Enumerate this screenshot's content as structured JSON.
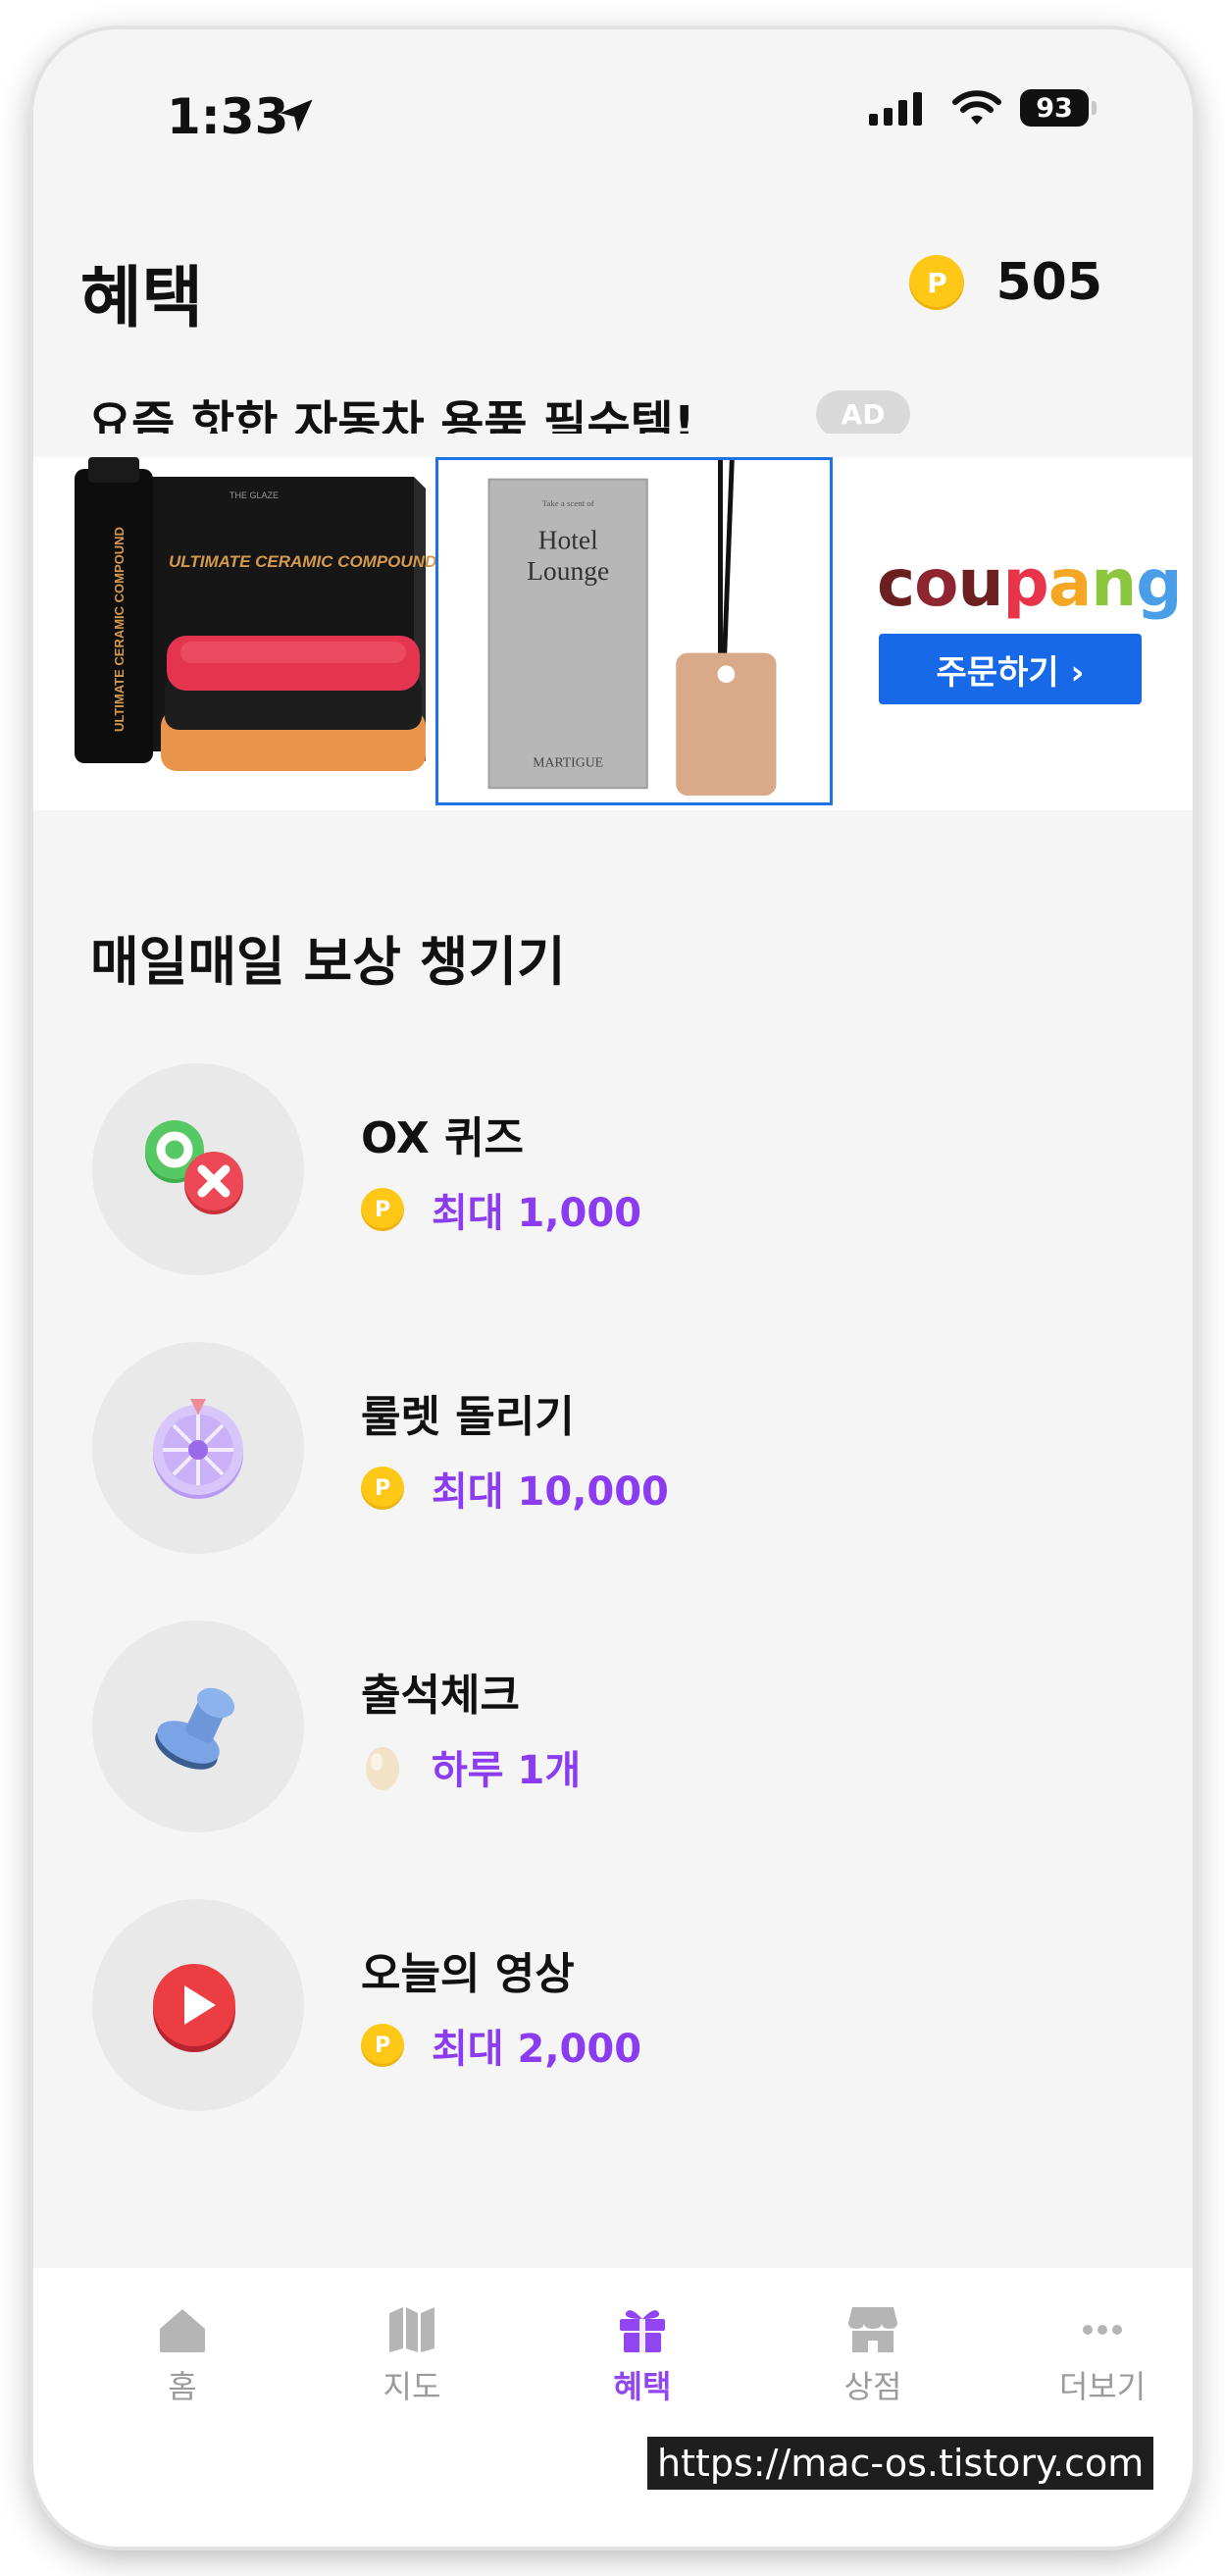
{
  "status_bar": {
    "time": "1:33",
    "battery": "93"
  },
  "header": {
    "title": "혜택",
    "points": "505",
    "coin_symbol": "P"
  },
  "ad": {
    "headline": "요즘 핫한 자동차 용품 필수템!",
    "badge": "AD",
    "product1": {
      "title": "ULTIMATE CERAMIC COMPOUND",
      "side_text": "ULTIMATE CERAMIC COMPOUND",
      "brand": "THE GLAZE"
    },
    "product2": {
      "small_text": "Take a scent of",
      "title_line1": "Hotel",
      "title_line2": "Lounge",
      "brand": "MARTIGUE"
    },
    "brand_logo": "coupang",
    "order_button": "주문하기 ›"
  },
  "rewards": {
    "section_title": "매일매일 보상 챙기기",
    "items": [
      {
        "name": "OX 퀴즈",
        "value": "최대 1,000",
        "icon": "ox-quiz-icon",
        "reward_type": "coin"
      },
      {
        "name": "룰렛 돌리기",
        "value": "최대 10,000",
        "icon": "roulette-icon",
        "reward_type": "coin"
      },
      {
        "name": "출석체크",
        "value": "하루 1개",
        "icon": "stamp-icon",
        "reward_type": "egg"
      },
      {
        "name": "오늘의 영상",
        "value": "최대 2,000",
        "icon": "video-play-icon",
        "reward_type": "coin"
      }
    ]
  },
  "tab_bar": {
    "items": [
      {
        "label": "홈",
        "icon": "home-icon",
        "active": false
      },
      {
        "label": "지도",
        "icon": "map-icon",
        "active": false
      },
      {
        "label": "혜택",
        "icon": "gift-icon",
        "active": true
      },
      {
        "label": "상점",
        "icon": "store-icon",
        "active": false
      },
      {
        "label": "더보기",
        "icon": "more-icon",
        "active": false
      }
    ]
  },
  "watermark": "https://mac-os.tistory.com",
  "colors": {
    "accent": "#8c3cf0",
    "coin": "#ffc817",
    "coupang_button": "#1769e8",
    "background": "#f5f5f5"
  }
}
